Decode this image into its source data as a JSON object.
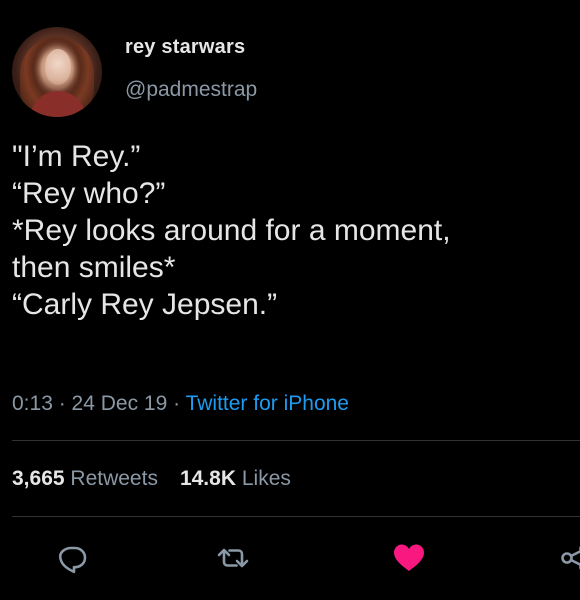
{
  "user": {
    "display_name": "rey starwars",
    "handle": "@padmestrap"
  },
  "tweet": {
    "text": "\"I’m Rey.”\n“Rey who?”\n*Rey looks around for a moment,\nthen smiles*\n“Carly Rey Jepsen.”"
  },
  "meta": {
    "time": "0:13",
    "sep1": " · ",
    "date": "24 Dec 19",
    "sep2": " · ",
    "source": "Twitter for iPhone"
  },
  "stats": {
    "retweets_count": "3,665",
    "retweets_label": "Retweets",
    "likes_count": "14.8K",
    "likes_label": "Likes"
  },
  "actions": {
    "reply_icon": "reply-icon",
    "retweet_icon": "retweet-icon",
    "like_icon": "heart-icon",
    "share_icon": "share-icon"
  },
  "colors": {
    "background": "#000000",
    "text": "#e6e6e6",
    "muted": "#8b98a5",
    "link": "#1d9bf0",
    "like": "#f91880"
  }
}
